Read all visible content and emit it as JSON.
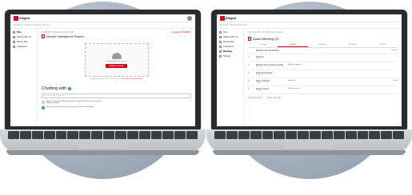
{
  "left": {
    "logo": "Diligent",
    "breadcrumb": "My Docs  >  Supplier Intelligence Report",
    "sidebar": [
      "Files",
      "Shared with me",
      "Recent files",
      "Collections"
    ],
    "sidebar_active_index": 0,
    "doc_meta": "SUPPLIER INTELLIGENCE REPORT",
    "doc_title": "Market Intelligence Report",
    "meta_right": "Due date: 06/08/2025",
    "upload_text": "Drag and drop files here, or",
    "upload_button": "Upload a new file",
    "upload_note": "Supported formats: PDF, DOCX, XLSX",
    "upload_note_link": "Learn more about uploading",
    "chat_title": "Chatting with",
    "chat_placeholder": "Ask Diligent AI a question",
    "messages": [
      {
        "text": "Make a list of all the key points from the document and summarize them",
        "time": "Today at 9:04 AM"
      },
      {
        "text": "Sure, here is a summary of the key points from the document",
        "time": ""
      }
    ]
  },
  "right": {
    "logo": "Diligent",
    "breadcrumb": "My Docs  >  Board Meeting Q3",
    "sidebar": [
      "Files",
      "Shared with me",
      "Recent files",
      "Collections",
      "Meetings",
      "Settings"
    ],
    "sidebar_active_index": 4,
    "doc_meta": "AGENDA FOR  ·  Q3 2025 board meeting",
    "doc_title": "Board Meeting Q3",
    "tabs": [
      "Overview",
      "Agenda",
      "Attendees",
      "Documents",
      "Minutes"
    ],
    "active_tab": 1,
    "rows": [
      {
        "num": "",
        "title": "Welcome and introductions",
        "sub": "",
        "status": "",
        "tag": "Complete"
      },
      {
        "num": "1",
        "title": "Welcome",
        "sub": "5 min",
        "status": "",
        "tag": ""
      },
      {
        "num": "2",
        "title": "Minutes of the previous meeting",
        "sub": "10 min",
        "status": "Awaiting approval",
        "tag": ""
      },
      {
        "num": "3",
        "title": "Financial Overview",
        "sub": "20 min",
        "status": "",
        "tag": ""
      },
      {
        "num": "4",
        "title": "Sales 20 Report",
        "sub": "15 min",
        "status": "Approved",
        "tag": "Ready"
      },
      {
        "num": "5",
        "title": "Finance Report",
        "sub": "10 min",
        "status": "Pending review",
        "tag": ""
      }
    ],
    "actions": [
      "Add agenda item",
      "Share with team"
    ]
  }
}
